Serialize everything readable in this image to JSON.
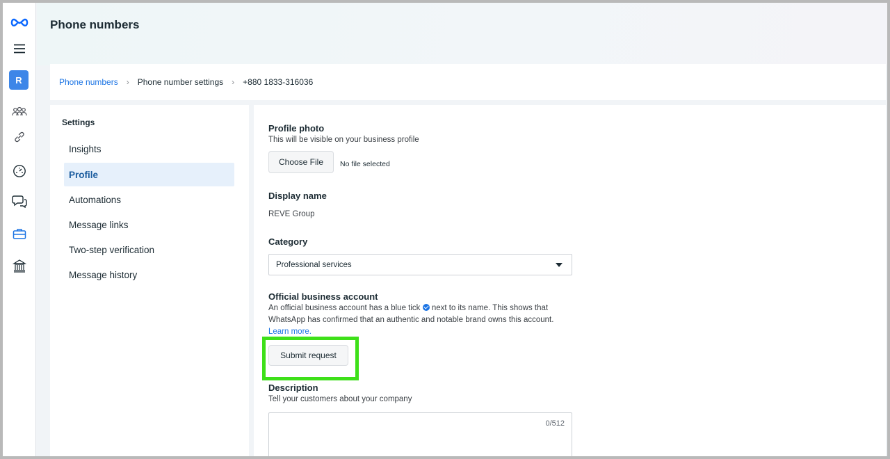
{
  "rail": {
    "avatar_letter": "R",
    "icons": [
      "meta-logo-icon",
      "menu-icon",
      "people-icon",
      "link-icon",
      "gauge-icon",
      "chat-icon",
      "briefcase-icon",
      "bank-icon"
    ]
  },
  "header": {
    "title": "Phone numbers"
  },
  "breadcrumb": {
    "items": [
      "Phone numbers",
      "Phone number settings",
      "+880 1833-316036"
    ]
  },
  "sidebar": {
    "heading": "Settings",
    "items": [
      {
        "label": "Insights",
        "active": false
      },
      {
        "label": "Profile",
        "active": true
      },
      {
        "label": "Automations",
        "active": false
      },
      {
        "label": "Message links",
        "active": false
      },
      {
        "label": "Two-step verification",
        "active": false
      },
      {
        "label": "Message history",
        "active": false
      }
    ]
  },
  "profile": {
    "photo_title": "Profile photo",
    "photo_sub": "This will be visible on your business profile",
    "choose_file_label": "Choose File",
    "file_status": "No file selected",
    "display_name_title": "Display name",
    "display_name_value": "REVE Group",
    "category_title": "Category",
    "category_value": "Professional services",
    "oba_title": "Official business account",
    "oba_text_1": "An official business account has a blue tick",
    "oba_text_2": "next to its name. This shows that WhatsApp has confirmed that an authentic and notable brand owns this account.",
    "oba_learn_more": "Learn more.",
    "submit_label": "Submit request",
    "description_title": "Description",
    "description_sub": "Tell your customers about your company",
    "description_counter": "0/512"
  },
  "colors": {
    "accent": "#1b74e4",
    "highlight": "#3ee019",
    "avatar": "#3d86e8"
  }
}
